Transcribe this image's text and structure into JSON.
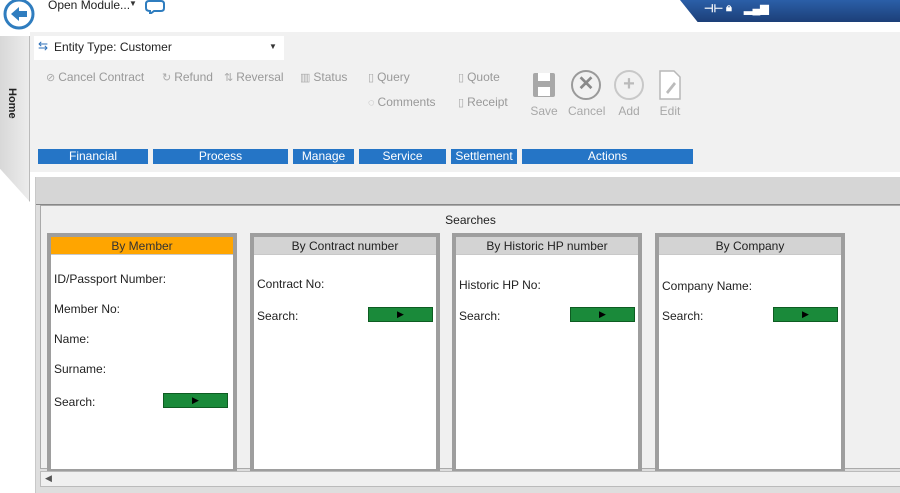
{
  "topbar": {
    "open_module": "Open Module...",
    "status_icons": [
      "pin-icon",
      "lock-icon",
      "signal-icon"
    ]
  },
  "sidebar": {
    "home_tab": "Home"
  },
  "entity_type": {
    "label": "Entity Type: Customer"
  },
  "ribbon": {
    "financial": {
      "cancel_contract": "Cancel Contract",
      "refund": "Refund",
      "reversal": "Reversal"
    },
    "process": {
      "status": "Status"
    },
    "manage": {
      "query": "Query",
      "comments": "Comments"
    },
    "service": {
      "quote": "Quote",
      "receipt": "Receipt"
    },
    "actions": {
      "save": "Save",
      "cancel": "Cancel",
      "add": "Add",
      "edit": "Edit"
    },
    "groups": [
      "Financial",
      "Process",
      "Manage",
      "Service",
      "Settlement",
      "Actions"
    ]
  },
  "searches": {
    "title": "Searches",
    "by_member": {
      "header": "By Member",
      "id_passport": "ID/Passport Number:",
      "member_no": "Member No:",
      "name": "Name:",
      "surname": "Surname:",
      "search": "Search:"
    },
    "by_contract": {
      "header": "By Contract number",
      "contract_no": "Contract No:",
      "search": "Search:"
    },
    "by_historic": {
      "header": "By Historic HP number",
      "historic_no": "Historic HP No:",
      "search": "Search:"
    },
    "by_company": {
      "header": "By Company",
      "company_name": "Company Name:",
      "search": "Search:"
    }
  },
  "colors": {
    "accent_blue": "#2575c6",
    "active_tab": "#ffa500",
    "go_green": "#1a8a3a"
  }
}
